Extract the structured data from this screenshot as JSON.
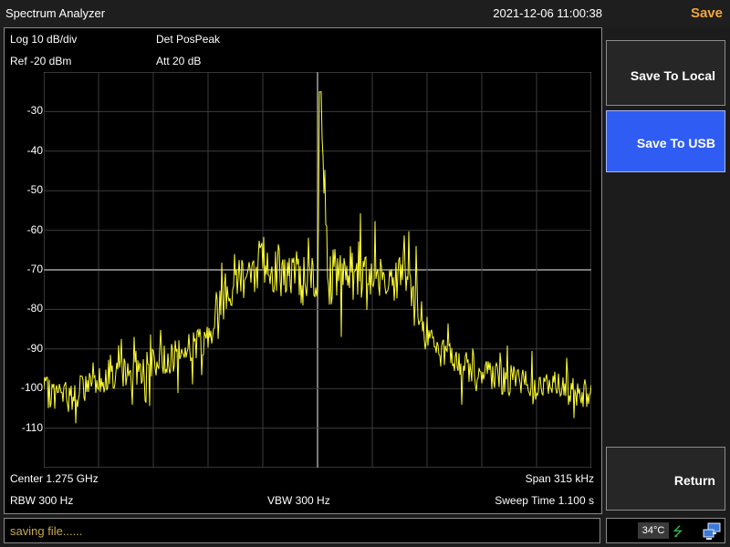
{
  "header": {
    "title": "Spectrum Analyzer",
    "datetime": "2021-12-06 11:00:38",
    "menu_title": "Save"
  },
  "display": {
    "scale_info": "Log 10 dB/div",
    "ref_level": "Ref -20 dBm",
    "detector": "Det PosPeak",
    "attenuation": "Att 20 dB",
    "center": "Center 1.275 GHz",
    "span": "Span 315 kHz",
    "rbw": "RBW 300 Hz",
    "vbw": "VBW 300 Hz",
    "sweep_time": "Sweep Time 1.100 s",
    "y_tick_labels": [
      "-30",
      "-40",
      "-50",
      "-60",
      "-70",
      "-80",
      "-90",
      "-100",
      "-110"
    ]
  },
  "chart_data": {
    "type": "line",
    "ylim": [
      -120,
      -20
    ],
    "xlim": [
      0,
      1
    ],
    "grid": true,
    "y_ticks": [
      -30,
      -40,
      -50,
      -60,
      -70,
      -80,
      -90,
      -100,
      -110
    ],
    "trace_color": "#ffff33",
    "series": [
      {
        "x": [
          0.0,
          0.05,
          0.1,
          0.15,
          0.2,
          0.25,
          0.3,
          0.32,
          0.35,
          0.4,
          0.45,
          0.5,
          0.505,
          0.52,
          0.55,
          0.6,
          0.65,
          0.68,
          0.7,
          0.75,
          0.8,
          0.85,
          0.9,
          0.95,
          1.0
        ],
        "y": [
          -101,
          -102,
          -97,
          -96,
          -94,
          -91,
          -87,
          -80,
          -72,
          -68,
          -71,
          -74,
          -25,
          -72,
          -71,
          -70,
          -71,
          -78,
          -88,
          -93,
          -96,
          -98,
          -99,
          -100,
          -101
        ]
      }
    ]
  },
  "softkeys": [
    {
      "label": "Save To Local",
      "active": false
    },
    {
      "label": "Save To USB",
      "active": true
    },
    {
      "label": "Return",
      "active": false
    }
  ],
  "status": {
    "message": "saving file......",
    "temperature": "34°C"
  },
  "icons": {
    "usb": "usb-icon",
    "pc": "pc-connection-icon"
  },
  "colors": {
    "menu_title": "#f3a63a",
    "active_key": "#2f5cf2",
    "trace": "#ffff33",
    "status_message": "#c7a94a"
  }
}
